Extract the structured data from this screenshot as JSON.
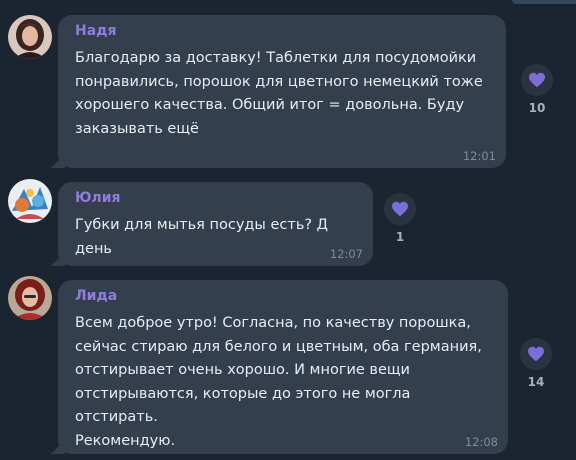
{
  "colors": {
    "background": "#1c242f",
    "bubble": "#343f4e",
    "sender_name": "#8e7ddb",
    "text": "#e8ecf1",
    "time": "#7d8a9b",
    "heart": "#7b6ed8"
  },
  "messages": [
    {
      "sender": "Надя",
      "text": "Благодарю за доставку! Таблетки для посудомойки\nпонравились, порошок для цветного немецкий тоже\nхорошего качества. Общий итог = довольна. Буду\nзаказывать ещё",
      "time": "12:01",
      "reaction": {
        "icon": "heart-icon",
        "count": "10"
      }
    },
    {
      "sender": "Юлия",
      "text": "Губки для мытья посуды есть? Д день",
      "time": "12:07",
      "reaction": {
        "icon": "heart-icon",
        "count": "1"
      }
    },
    {
      "sender": "Лида",
      "text": "Всем доброе утро! Согласна, по качеству порошка,\nсейчас стираю для белого и цветным, оба германия,\nотстирывает очень хорошо. И многие вещи\nотстирываются, которые до этого не могла отстирать.\nРекомендую.",
      "time": "12:08",
      "reaction": {
        "icon": "heart-icon",
        "count": "14"
      }
    }
  ]
}
